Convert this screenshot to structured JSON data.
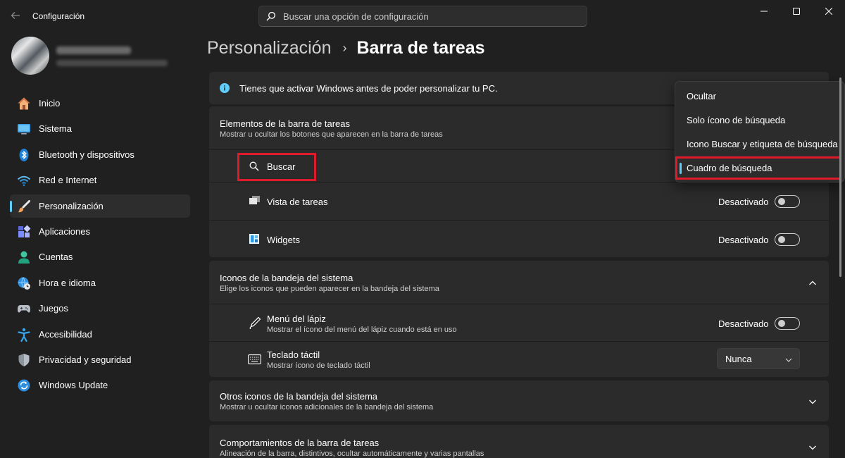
{
  "window": {
    "title": "Configuración",
    "back_icon": "arrow-left-icon"
  },
  "search": {
    "placeholder": "Buscar una opción de configuración",
    "icon": "search-icon"
  },
  "window_controls": [
    "minimize-icon",
    "maximize-icon",
    "close-icon"
  ],
  "sidebar": {
    "items": [
      {
        "label": "Inicio",
        "icon": "home-icon"
      },
      {
        "label": "Sistema",
        "icon": "monitor-icon"
      },
      {
        "label": "Bluetooth y dispositivos",
        "icon": "bluetooth-icon"
      },
      {
        "label": "Red e Internet",
        "icon": "wifi-icon"
      },
      {
        "label": "Personalización",
        "icon": "brush-icon",
        "selected": true
      },
      {
        "label": "Aplicaciones",
        "icon": "apps-icon"
      },
      {
        "label": "Cuentas",
        "icon": "person-icon"
      },
      {
        "label": "Hora e idioma",
        "icon": "globe-clock-icon"
      },
      {
        "label": "Juegos",
        "icon": "gamepad-icon"
      },
      {
        "label": "Accesibilidad",
        "icon": "accessibility-icon"
      },
      {
        "label": "Privacidad y seguridad",
        "icon": "shield-icon"
      },
      {
        "label": "Windows Update",
        "icon": "update-icon"
      }
    ]
  },
  "breadcrumb": {
    "parent": "Personalización",
    "separator": "›",
    "current": "Barra de tareas"
  },
  "notice": {
    "text": "Tienes que activar Windows antes de poder personalizar tu PC.",
    "icon": "info-icon"
  },
  "taskbar_items": {
    "title": "Elementos de la barra de tareas",
    "subtitle": "Mostrar u ocultar los botones que aparecen en la barra de tareas",
    "search": {
      "label": "Buscar",
      "icon": "search-icon"
    },
    "task_view": {
      "label": "Vista de tareas",
      "state": "Desactivado",
      "icon": "task-view-icon"
    },
    "widgets": {
      "label": "Widgets",
      "state": "Desactivado",
      "icon": "widgets-icon"
    }
  },
  "tray_icons": {
    "title": "Iconos de la bandeja del sistema",
    "subtitle": "Elige los iconos que pueden aparecer en la bandeja del sistema",
    "pen_menu": {
      "label": "Menú del lápiz",
      "sublabel": "Mostrar el ícono del menú del lápiz cuando está en uso",
      "state": "Desactivado",
      "icon": "pen-icon"
    },
    "touch_keyboard": {
      "label": "Teclado táctil",
      "sublabel": "Mostrar ícono de teclado táctil",
      "value": "Nunca",
      "icon": "keyboard-icon"
    }
  },
  "other_tray": {
    "title": "Otros iconos de la bandeja del sistema",
    "subtitle": "Mostrar u ocultar iconos adicionales de la bandeja del sistema"
  },
  "behaviors": {
    "title": "Comportamientos de la barra de tareas",
    "subtitle": "Alineación de la barra, distintivos, ocultar automáticamente y varias pantallas"
  },
  "search_dropdown": {
    "options": [
      "Ocultar",
      "Solo ícono de búsqueda",
      "Icono Buscar y etiqueta de búsqueda",
      "Cuadro de búsqueda"
    ],
    "selected": "Cuadro de búsqueda"
  },
  "colors": {
    "accent": "#60cdff",
    "highlight": "#e0192b",
    "background": "#202020",
    "card": "#2b2b2b"
  }
}
